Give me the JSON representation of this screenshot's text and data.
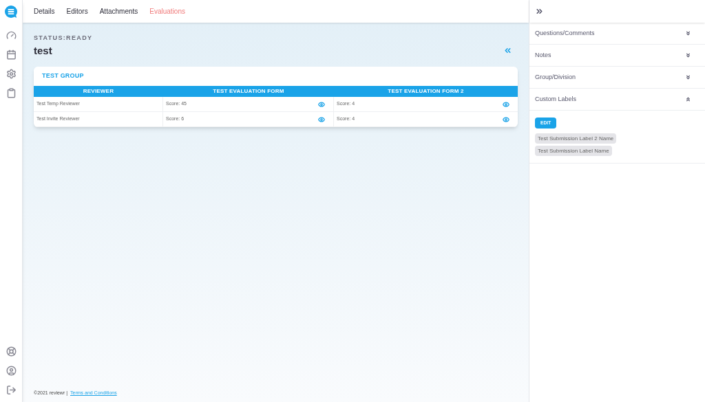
{
  "tabs": [
    {
      "label": "Details",
      "selected": false
    },
    {
      "label": "Editors",
      "selected": false
    },
    {
      "label": "Attachments",
      "selected": false
    },
    {
      "label": "Evaluations",
      "selected": true
    }
  ],
  "status": "STATUS:READY",
  "title": "test",
  "group": {
    "title": "TEST GROUP",
    "columns": [
      "REVIEWER",
      "TEST EVALUATION FORM",
      "TEST EVALUATION FORM 2"
    ],
    "rows": [
      {
        "reviewer": "Test Temp Reviewer",
        "scores": [
          "Score: 45",
          "Score: 4"
        ]
      },
      {
        "reviewer": "Test Invite Reviewer",
        "scores": [
          "Score: 6",
          "Score: 4"
        ]
      }
    ]
  },
  "panel": {
    "sections": [
      {
        "title": "Questions/Comments",
        "expanded": false
      },
      {
        "title": "Notes",
        "expanded": false
      },
      {
        "title": "Group/Division",
        "expanded": false
      },
      {
        "title": "Custom Labels",
        "expanded": true
      }
    ],
    "edit_button": "EDIT",
    "labels": [
      "Test Submission Label 2 Name",
      "Test Submission Label Name"
    ]
  },
  "footer": {
    "text": "©2021 reviewr |",
    "link": "Terms and Conditions"
  }
}
